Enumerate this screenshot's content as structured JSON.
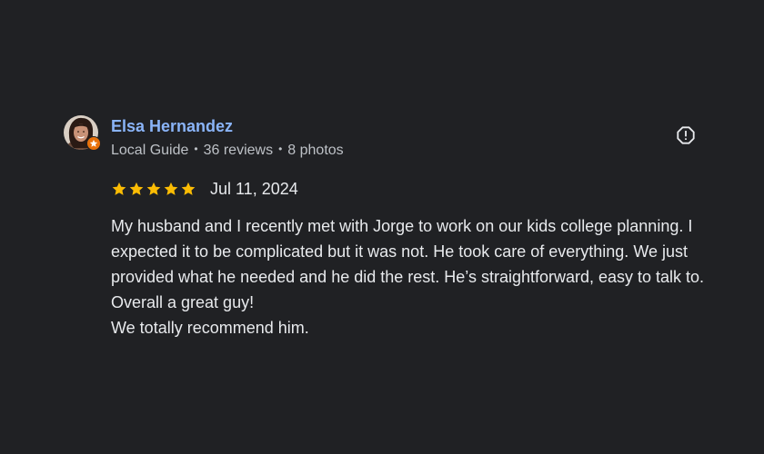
{
  "reviewer": {
    "name": "Elsa Hernandez",
    "badge": "Local Guide",
    "reviews": "36 reviews",
    "photos": "8 photos",
    "separator": "•"
  },
  "review": {
    "rating": 5,
    "max_rating": 5,
    "date": "Jul 11, 2024",
    "paragraphs": [
      "My husband and I recently met with Jorge to work on our kids college planning. I expected it to be complicated but it was not. He took care of everything. We just provided what he needed and he did the rest. He’s straightforward, easy to talk to. Overall a great guy!",
      "We totally recommend him."
    ]
  },
  "icons": {
    "flag": "report-flag-icon",
    "star": "star-icon",
    "badge": "local-guide-star-icon"
  },
  "colors": {
    "background": "#202124",
    "name": "#8ab4f8",
    "star": "#fbbc04",
    "badge": "#e8710a",
    "meta": "#bdc1c6",
    "text": "#e8eaed"
  }
}
